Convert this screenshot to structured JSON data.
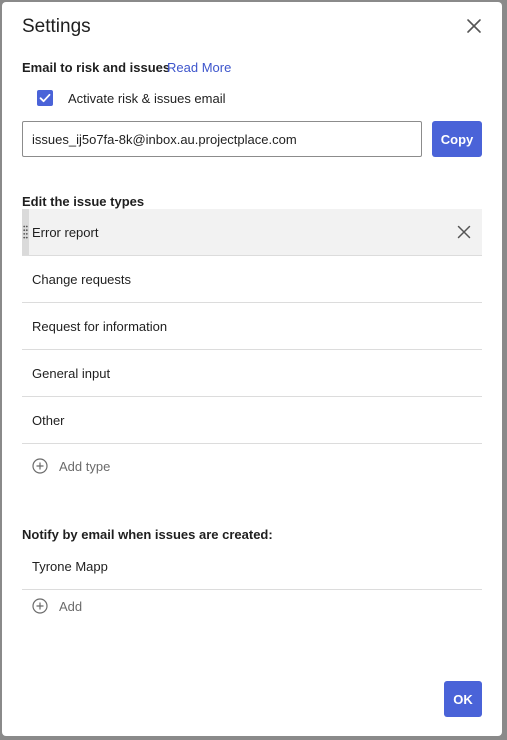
{
  "dialog": {
    "title": "Settings",
    "close_icon": "close-icon"
  },
  "email_section": {
    "heading": "Email to risk and issues",
    "read_more": "Read More",
    "activate_label": "Activate risk & issues email",
    "activate_checked": true,
    "email_address": "issues_ij5o7fa-8k@inbox.au.projectplace.com",
    "copy_label": "Copy"
  },
  "issue_types": {
    "heading": "Edit the issue types",
    "items": [
      {
        "label": "Error report"
      },
      {
        "label": "Change requests"
      },
      {
        "label": "Request for information"
      },
      {
        "label": "General input"
      },
      {
        "label": "Other"
      }
    ],
    "add_label": "Add type"
  },
  "notify": {
    "heading": "Notify by email when issues are created:",
    "people": [
      {
        "name": "Tyrone Mapp"
      }
    ],
    "add_label": "Add"
  },
  "footer": {
    "ok_label": "OK"
  },
  "colors": {
    "accent": "#4a63d8",
    "link": "#3d55cc",
    "divider": "#dcdcdc",
    "active_row": "#f2f2f2"
  }
}
